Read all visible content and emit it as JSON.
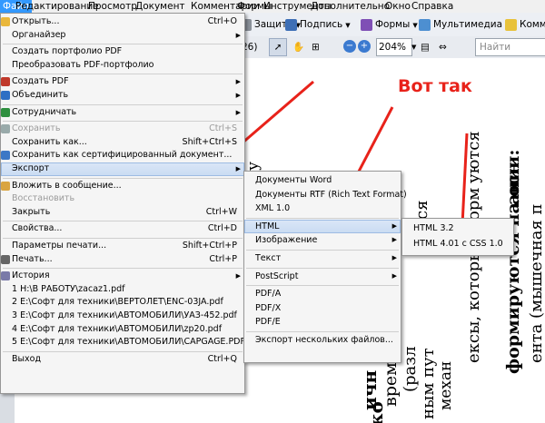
{
  "menubar": [
    "Файл",
    "Редактирование",
    "Просмотр",
    "Документ",
    "Комментарии",
    "Формы",
    "Инструменты",
    "Дополнительно",
    "Окно",
    "Справка"
  ],
  "toolbar": {
    "protect": "Защита",
    "sign": "Подпись",
    "forms": "Формы",
    "multimedia": "Мультимедиа",
    "comments": "Комме",
    "page_num": "26)",
    "zoom": "204%",
    "search_placeholder": "Найти"
  },
  "file_menu": [
    {
      "label": "Открыть...",
      "shortcut": "Ctrl+O",
      "icon": "folder-icon"
    },
    {
      "label": "Органайзер",
      "sub": true
    },
    {
      "sep": true
    },
    {
      "label": "Создать портфолио PDF"
    },
    {
      "label": "Преобразовать PDF-портфолио"
    },
    {
      "sep": true
    },
    {
      "label": "Создать PDF",
      "sub": true,
      "icon": "create-pdf-icon"
    },
    {
      "label": "Объединить",
      "sub": true,
      "icon": "combine-icon"
    },
    {
      "sep": true
    },
    {
      "label": "Сотрудничать",
      "sub": true,
      "icon": "collaborate-icon"
    },
    {
      "sep": true
    },
    {
      "label": "Сохранить",
      "shortcut": "Ctrl+S",
      "disabled": true,
      "icon": "save-icon"
    },
    {
      "label": "Сохранить как...",
      "shortcut": "Shift+Ctrl+S"
    },
    {
      "label": "Сохранить как сертифицированный документ...",
      "icon": "certificate-icon"
    },
    {
      "label": "Экспорт",
      "sub": true,
      "highlight": true
    },
    {
      "sep": true
    },
    {
      "label": "Вложить в сообщение...",
      "icon": "mail-icon"
    },
    {
      "label": "Восстановить",
      "disabled": true
    },
    {
      "label": "Закрыть",
      "shortcut": "Ctrl+W"
    },
    {
      "sep": true
    },
    {
      "label": "Свойства...",
      "shortcut": "Ctrl+D"
    },
    {
      "sep": true
    },
    {
      "label": "Параметры печати...",
      "shortcut": "Shift+Ctrl+P"
    },
    {
      "label": "Печать...",
      "shortcut": "Ctrl+P",
      "icon": "print-icon"
    },
    {
      "sep": true
    },
    {
      "label": "История",
      "sub": true,
      "icon": "history-icon"
    },
    {
      "label": "1 H:\\В РАБОТУ\\zacaz1.pdf"
    },
    {
      "label": "2 E:\\Софт для техники\\ВЕРТОЛЕТ\\ENC-03JA.pdf"
    },
    {
      "label": "3 E:\\Софт для техники\\АВТОМОБИЛИ\\УАЗ-452.pdf"
    },
    {
      "label": "4 E:\\Софт для техники\\АВТОМОБИЛИ\\zp20.pdf"
    },
    {
      "label": "5 E:\\Софт для техники\\АВТОМОБИЛИ\\CAPGAGE.PDF"
    },
    {
      "sep": true
    },
    {
      "label": "Выход",
      "shortcut": "Ctrl+Q"
    }
  ],
  "export_menu": [
    {
      "label": "Документы Word"
    },
    {
      "label": "Документы RTF (Rich Text Format)"
    },
    {
      "label": "XML 1.0"
    },
    {
      "sep": true
    },
    {
      "label": "HTML",
      "sub": true,
      "highlight": true
    },
    {
      "label": "Изображение",
      "sub": true
    },
    {
      "sep": true
    },
    {
      "label": "Текст",
      "sub": true
    },
    {
      "sep": true
    },
    {
      "label": "PostScript",
      "sub": true
    },
    {
      "sep": true
    },
    {
      "label": "PDF/A"
    },
    {
      "label": "PDF/X"
    },
    {
      "label": "PDF/E"
    },
    {
      "sep": true
    },
    {
      "label": "Экспорт нескольких файлов..."
    }
  ],
  "html_menu": [
    {
      "label": "HTML 3.2"
    },
    {
      "label": "HTML 4.01 с CSS 1.0"
    }
  ],
  "annotation": "Вот так",
  "document_columns": [
    "ичн",
    "ко",
    "врем",
    "(разл",
    "ным пут",
    "механ",
    "ексы, которые форм",
    "уются",
    "формируются на осн",
    "ании:",
    "ента (мышечная п",
    "ьных навыков наблюдается",
    "ов",
    "ся",
    "у"
  ],
  "colors": {
    "annotation": "#e8221a",
    "menu_highlight": "#c9dbf2",
    "menubar_active": "#3399ff"
  }
}
